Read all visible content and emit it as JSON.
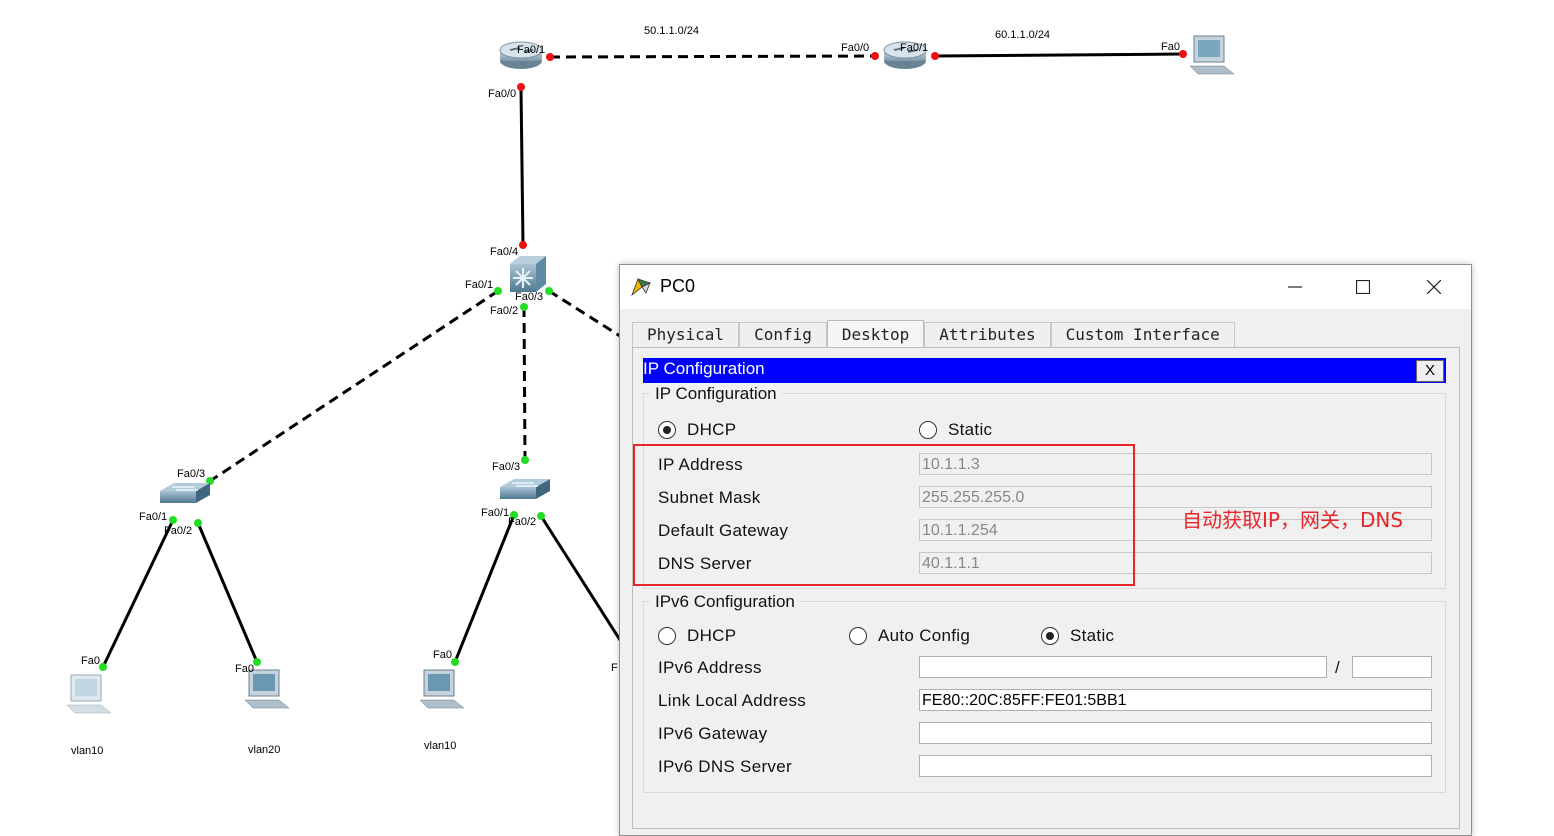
{
  "topology": {
    "subnets": [
      "50.1.1.0/24",
      "60.1.1.0/24"
    ],
    "ports": {
      "r1_fa01": "Fa0/1",
      "r1_fa00": "Fa0/0",
      "r2_fa00": "Fa0/0",
      "r2_fa01": "Fa0/1",
      "pc_top_fa0": "Fa0",
      "ms_fa04": "Fa0/4",
      "ms_fa01": "Fa0/1",
      "ms_fa03": "Fa0/3",
      "ms_fa02": "Fa0/2",
      "sw1_fa03": "Fa0/3",
      "sw1_fa01": "Fa0/1",
      "sw1_fa02": "Fa0/2",
      "sw2_fa03": "Fa0/3",
      "sw2_fa01": "Fa0/1",
      "sw2_fa02": "Fa0/2",
      "pc1_fa0": "Fa0",
      "pc2_fa0": "Fa0",
      "pc3_fa0": "Fa0",
      "pc4_fa0": "F"
    },
    "pc_labels": [
      "vlan10",
      "vlan20",
      "vlan10"
    ]
  },
  "window": {
    "title": "PC0",
    "tabs": [
      "Physical",
      "Config",
      "Desktop",
      "Attributes",
      "Custom Interface"
    ],
    "active_tab": "Desktop"
  },
  "ip_config": {
    "header": "IP Configuration",
    "close_label": "X",
    "group_title": "IP Configuration",
    "dhcp_label": "DHCP",
    "static_label": "Static",
    "mode": "DHCP",
    "ip_address_label": "IP Address",
    "ip_address": "10.1.1.3",
    "subnet_mask_label": "Subnet Mask",
    "subnet_mask": "255.255.255.0",
    "gateway_label": "Default Gateway",
    "gateway": "10.1.1.254",
    "dns_label": "DNS Server",
    "dns": "40.1.1.1"
  },
  "ipv6_config": {
    "group_title": "IPv6 Configuration",
    "dhcp_label": "DHCP",
    "auto_label": "Auto Config",
    "static_label": "Static",
    "mode": "Static",
    "address_label": "IPv6 Address",
    "address": "",
    "slash": "/",
    "prefix": "",
    "link_local_label": "Link Local Address",
    "link_local": "FE80::20C:85FF:FE01:5BB1",
    "gateway_label": "IPv6 Gateway",
    "gateway": "",
    "dns_label": "IPv6 DNS Server",
    "dns": ""
  },
  "annotation": {
    "text": "自动获取IP，网关，DNS",
    "color": "#e8262a"
  },
  "colors": {
    "header_bar": "#0000ff",
    "link_up": "#22dd22",
    "link_down": "#ee1111"
  }
}
